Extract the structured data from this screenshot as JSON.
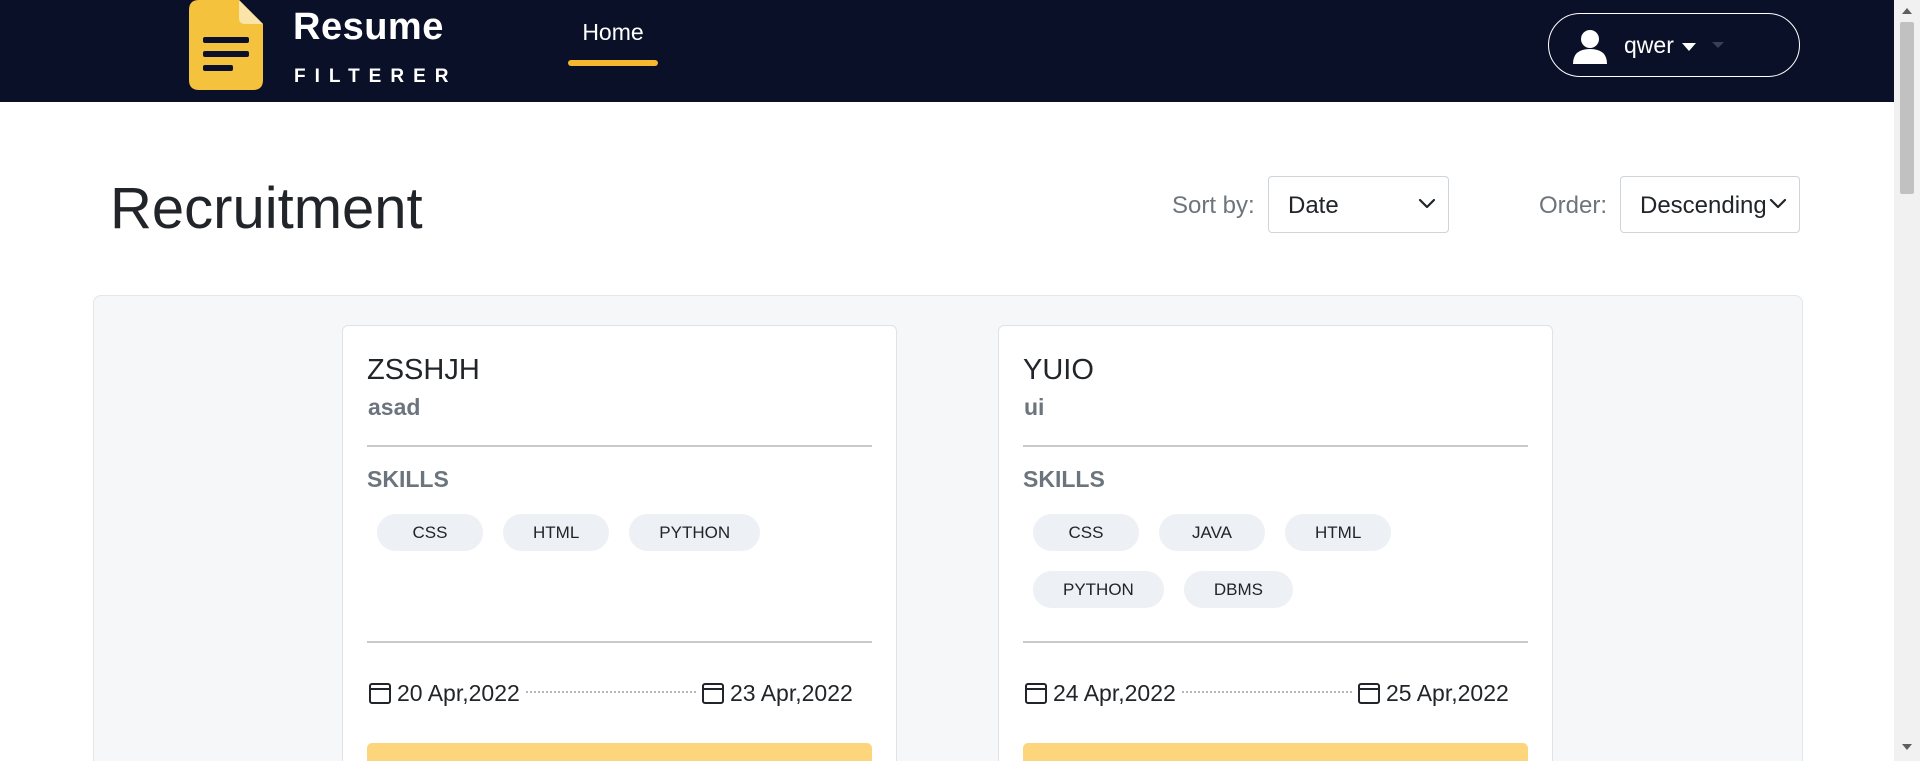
{
  "brand": {
    "word": "Resume",
    "sub": "FILTERER"
  },
  "nav": {
    "home_label": "Home"
  },
  "user": {
    "name": "qwer"
  },
  "page": {
    "title": "Recruitment"
  },
  "sort": {
    "label": "Sort by:",
    "value": "Date"
  },
  "order": {
    "label": "Order:",
    "value": "Descending"
  },
  "cards": [
    {
      "title": "ZSSHJH",
      "subtitle": "asad",
      "skills_heading": "SKILLS",
      "skills": [
        "CSS",
        "HTML",
        "PYTHON"
      ],
      "start_date": "20 Apr,2022",
      "end_date": "23 Apr,2022"
    },
    {
      "title": "YUIO",
      "subtitle": "ui",
      "skills_heading": "SKILLS",
      "skills": [
        "CSS",
        "JAVA",
        "HTML",
        "PYTHON",
        "DBMS"
      ],
      "start_date": "24 Apr,2022",
      "end_date": "25 Apr,2022"
    }
  ],
  "colors": {
    "navbar": "#0b1029",
    "accent": "#f5b82e",
    "action_button": "#fdd57c",
    "chip_bg": "#edf0f4",
    "panel_bg": "#f6f7f9"
  },
  "icons": {
    "logo": "document-icon",
    "user": "user-icon",
    "sort_chevron": "chevron-down-icon",
    "date": "calendar-icon"
  }
}
